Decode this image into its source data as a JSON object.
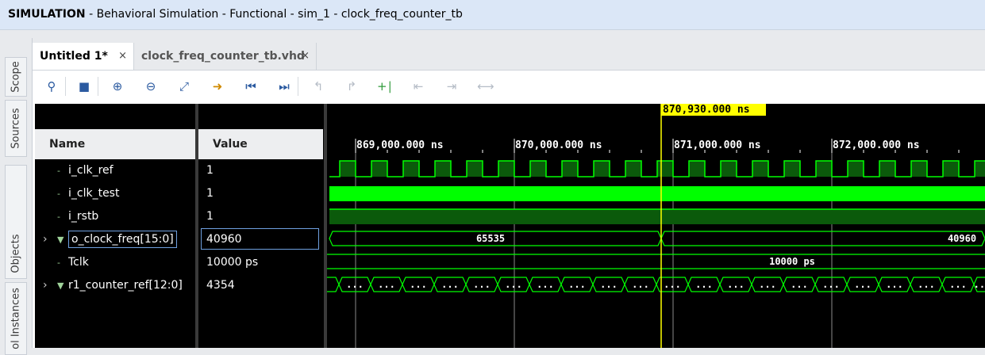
{
  "titlebar": {
    "mode": "SIMULATION",
    "rest": " - Behavioral Simulation - Functional - sim_1 - clock_freq_counter_tb"
  },
  "side_tabs": [
    "Scope",
    "Sources",
    "Objects",
    "ol Instances"
  ],
  "tabs": {
    "active": "Untitled 1*",
    "inactive": "clock_freq_counter_tb.vhd",
    "close": "×"
  },
  "toolbar_icons": [
    "search-icon",
    "save-icon",
    "zoom-in-icon",
    "zoom-out-icon",
    "zoom-fit-icon",
    "go-to-cursor-icon",
    "go-to-time-zero-icon",
    "go-to-last-time-icon",
    "previous-transition-icon",
    "next-transition-icon",
    "add-marker-icon",
    "previous-marker-icon",
    "next-marker-icon",
    "swap-cursors-icon"
  ],
  "columns": {
    "name": "Name",
    "value": "Value"
  },
  "signals": [
    {
      "name": "i_clk_ref",
      "value": "1",
      "expandable": false
    },
    {
      "name": "i_clk_test",
      "value": "1",
      "expandable": false
    },
    {
      "name": "i_rstb",
      "value": "1",
      "expandable": false
    },
    {
      "name": "o_clock_freq[15:0]",
      "value": "40960",
      "expandable": true
    },
    {
      "name": "Tclk",
      "value": "10000 ps",
      "expandable": false
    },
    {
      "name": "r1_counter_ref[12:0]",
      "value": "4354",
      "expandable": true
    }
  ],
  "waveform": {
    "cursor_time": "870,930.000 ns",
    "time_markers": [
      "869,000.000 ns",
      "870,000.000 ns",
      "871,000.000 ns",
      "872,000.000 ns"
    ],
    "bus_values": {
      "o_clock_freq_before": "65535",
      "o_clock_freq_after": "40960",
      "tclk": "10000 ps",
      "counter": "..."
    },
    "colors": {
      "wave": "#00ff00",
      "cursor": "#ffff00",
      "background": "#000000"
    }
  }
}
